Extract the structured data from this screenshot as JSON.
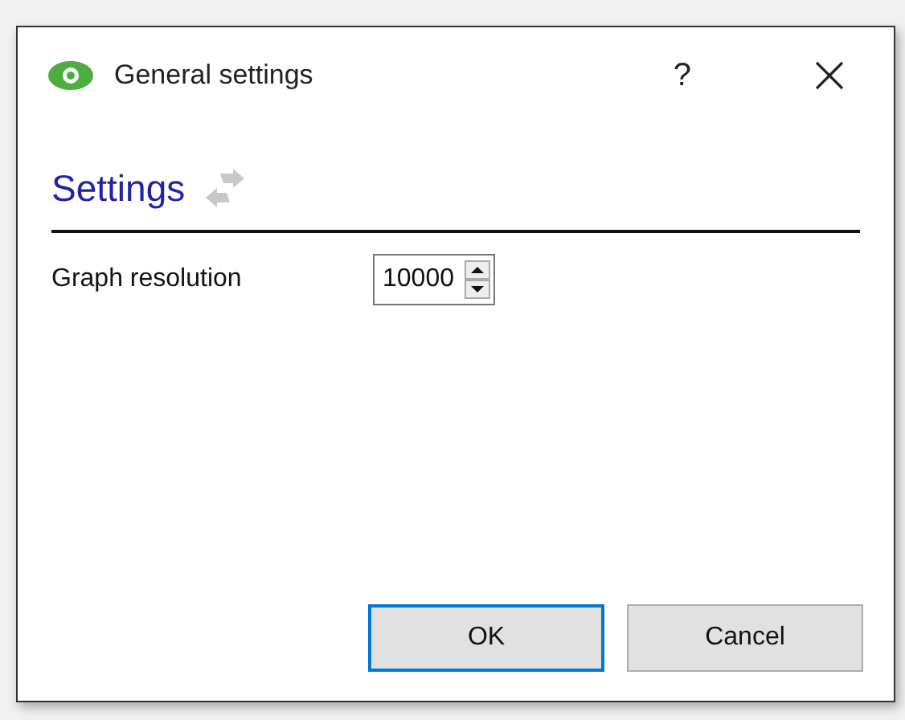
{
  "window": {
    "title": "General settings",
    "help": "?"
  },
  "section": {
    "title": "Settings"
  },
  "fields": [
    {
      "label": "Graph resolution",
      "value": "10000"
    }
  ],
  "buttons": [
    {
      "label": "OK",
      "default": true
    },
    {
      "label": "Cancel",
      "default": false
    }
  ]
}
